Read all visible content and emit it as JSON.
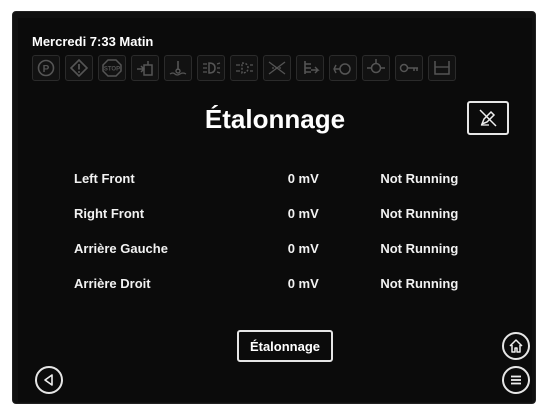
{
  "status_bar": {
    "clock": "Mercredi 7:33 Matin",
    "icons": [
      "parking-brake-icon",
      "warning-icon",
      "stop-icon",
      "hand-tank-icon",
      "coolant-temp-icon",
      "lights-icon",
      "lamp-icon",
      "exhaust-icon",
      "oil-icon",
      "pump-icon",
      "filter-icon",
      "key-icon",
      "tank-icon"
    ]
  },
  "page": {
    "title": "Étalonnage",
    "corner_icon": "edit-off-icon"
  },
  "sensors": [
    {
      "name": "Left Front",
      "value": "0 mV",
      "status": "Not Running"
    },
    {
      "name": "Right Front",
      "value": "0 mV",
      "status": "Not Running"
    },
    {
      "name": "Arrière Gauche",
      "value": "0 mV",
      "status": "Not Running"
    },
    {
      "name": "Arrière Droit",
      "value": "0 mV",
      "status": "Not Running"
    }
  ],
  "actions": {
    "calibrate_label": "Étalonnage"
  },
  "nav": {
    "back_icon": "back-triangle-icon",
    "home_icon": "home-icon",
    "menu_icon": "menu-icon"
  },
  "colors": {
    "background": "#0b0b0b",
    "text": "#f2f2f2",
    "dim_icon": "#555555"
  }
}
